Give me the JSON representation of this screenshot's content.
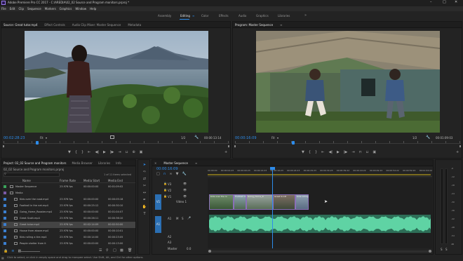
{
  "window": {
    "title": "Adobe Premiere Pro CC 2017 - C:\\AREDIA\\02_02 Source and Program monitors.prproj *",
    "controls": [
      "–",
      "□",
      "✕"
    ]
  },
  "menu": [
    "File",
    "Edit",
    "Clip",
    "Sequence",
    "Markers",
    "Graphics",
    "Window",
    "Help"
  ],
  "workspaces": {
    "items": [
      "Assembly",
      "Editing",
      "Color",
      "Effects",
      "Audio",
      "Graphics",
      "Libraries"
    ],
    "active": "Editing",
    "more": "»"
  },
  "source": {
    "tabs": [
      "Source: Great tutor.mp4",
      "Effect Controls",
      "Audio Clip Mixer: Master Sequence",
      "Metadata"
    ],
    "timecode_in": "00:02:28:23",
    "fit": "Fit",
    "fraction": "1/2",
    "timecode_dur": "00:00:13:14"
  },
  "program": {
    "tabs": [
      "Program: Master Sequence"
    ],
    "timecode_in": "00:00:16:09",
    "fit": "Fit",
    "fraction": "1/2",
    "timecode_dur": "00:01:09:03"
  },
  "project": {
    "tabs": [
      "Project: 02_02 Source and Program monitors",
      "Media Browser",
      "Libraries",
      "Info"
    ],
    "path": "02_02 Source and Program monitors.prproj",
    "items_selected": "1 of 11 items selected",
    "columns": [
      "Name",
      "Frame Rate",
      "Media Start",
      "Media End"
    ],
    "rows": [
      {
        "name": "Master Sequence",
        "rate": "23.976 fps",
        "start": "00:00:00:00",
        "end": "00:01:09:02",
        "color": "#3aa35a"
      },
      {
        "name": "Media",
        "rate": "",
        "start": "",
        "end": "",
        "color": "#7b5aa6"
      },
      {
        "name": "Kids over the road.mp4",
        "rate": "23.976 fps",
        "start": "00:00:00:00",
        "end": "00:00:05:18",
        "color": "#3b7fd0"
      },
      {
        "name": "Football in the net.mp4",
        "rate": "23.976 fps",
        "start": "00:00:25:12",
        "end": "00:00:30:10",
        "color": "#3b7fd0"
      },
      {
        "name": "Going_Home_Rooster.mp4",
        "rate": "23.976 fps",
        "start": "00:00:00:00",
        "end": "00:01:04:07",
        "color": "#3b7fd0"
      },
      {
        "name": "Great Scott.mp4",
        "rate": "23.976 fps",
        "start": "00:00:26:11",
        "end": "00:00:36:10",
        "color": "#3b7fd0"
      },
      {
        "name": "Great tutor.mp4",
        "rate": "23.976 fps",
        "start": "00:02:14:09",
        "end": "00:02:50:00",
        "color": "#3b7fd0"
      },
      {
        "name": "House from above.mp4",
        "rate": "23.976 fps",
        "start": "00:00:00:00",
        "end": "00:00:10:01",
        "color": "#3b7fd0"
      },
      {
        "name": "Kids rolling a tire.mp4",
        "rate": "23.976 fps",
        "start": "00:00:14:00",
        "end": "00:00:23:05",
        "color": "#3b7fd0"
      },
      {
        "name": "People shelter from it",
        "rate": "23.976 fps",
        "start": "00:00:00:00",
        "end": "00:00:13:00",
        "color": "#3b7fd0"
      }
    ],
    "selected_row": 6
  },
  "timeline": {
    "tab": "Master Sequence",
    "timecode": "00:00:16:09",
    "ruler": [
      "00:00:00",
      "00:00:04:23",
      "00:00:09:23",
      "00:00:14:23",
      "00:00:19:23",
      "00:00:24:23",
      "00:00:29:23",
      "00:00:34:23",
      "00:00:39:22",
      "00:00:44:22",
      "00:00:49:22",
      "00:00:54:22",
      "00:00:59:22",
      "00:01:04:22"
    ],
    "video_tracks": [
      "V3",
      "V2",
      "V1"
    ],
    "audio_tracks": [
      "A1",
      "A2",
      "A3"
    ],
    "master": "Master",
    "master_value": "0.0",
    "track_target_labels": [
      "V1",
      "A1"
    ],
    "video1_label": "Video 1",
    "clip_labels": [
      "Kids over the ro",
      "Football in th",
      "Going_Home_R",
      "Great Scott",
      "Kids rolling"
    ]
  },
  "meter": {
    "scale": [
      "-6",
      "-12",
      "-18",
      "-24",
      "-30",
      "-36",
      "-42",
      "-48",
      "-54",
      "dB"
    ],
    "channels": [
      "S",
      "S"
    ]
  },
  "status": {
    "text": "Click to select, or click in empty space and drag to marquee select. Use Shift, Alt, and Ctrl for other options."
  }
}
